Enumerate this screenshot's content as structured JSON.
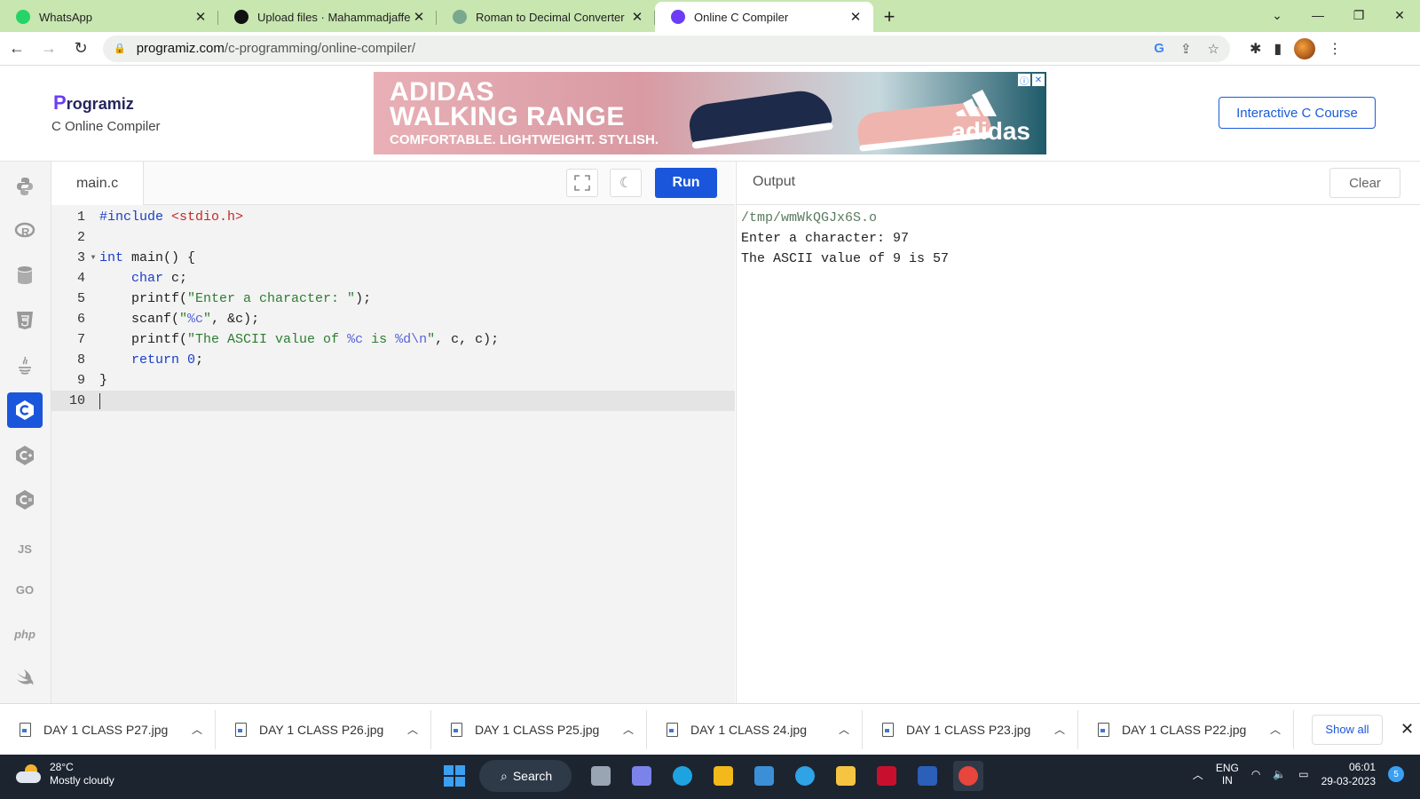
{
  "browser": {
    "tabs": [
      {
        "title": "WhatsApp",
        "favicon": "whatsapp-icon",
        "color": "#25d366",
        "active": false
      },
      {
        "title": "Upload files · Mahammadjaffer/C",
        "favicon": "github-icon",
        "color": "#111111",
        "active": false
      },
      {
        "title": "Roman to Decimal Converter",
        "favicon": "chatgpt-icon",
        "color": "#7aa88e",
        "active": false
      },
      {
        "title": "Online C Compiler",
        "favicon": "programiz-icon",
        "color": "#6c3df4",
        "active": true
      }
    ],
    "url_host": "programiz.com",
    "url_path": "/c-programming/online-compiler/"
  },
  "site": {
    "logo_text": "rogramiz",
    "logo_letter": "P",
    "subtitle": "C Online Compiler",
    "course_button": "Interactive C Course"
  },
  "ad": {
    "line1": "ADIDAS",
    "line2": "WALKING RANGE",
    "line3": "COMFORTABLE. LIGHTWEIGHT. STYLISH.",
    "brand": "adidas"
  },
  "sidebar": {
    "languages": [
      {
        "name": "python",
        "label": "",
        "active": false
      },
      {
        "name": "r",
        "label": "",
        "active": false
      },
      {
        "name": "sql",
        "label": "",
        "active": false
      },
      {
        "name": "html",
        "label": "",
        "active": false
      },
      {
        "name": "java",
        "label": "",
        "active": false
      },
      {
        "name": "c",
        "label": "",
        "active": true
      },
      {
        "name": "cpp",
        "label": "",
        "active": false
      },
      {
        "name": "csharp",
        "label": "",
        "active": false
      },
      {
        "name": "js",
        "label": "JS",
        "active": false
      },
      {
        "name": "go",
        "label": "GO",
        "active": false
      },
      {
        "name": "php",
        "label": "php",
        "active": false
      },
      {
        "name": "swift",
        "label": "",
        "active": false
      }
    ]
  },
  "editor": {
    "filename": "main.c",
    "run_label": "Run",
    "lines": [
      {
        "num": "1",
        "html": "<span class=\"kw\">#include</span> <span class=\"inc\">&lt;stdio.h&gt;</span>"
      },
      {
        "num": "2",
        "html": ""
      },
      {
        "num": "3",
        "html": "<span class=\"kw\">int</span> main() {",
        "fold": true
      },
      {
        "num": "4",
        "html": "    <span class=\"kw\">char</span> c;"
      },
      {
        "num": "5",
        "html": "    printf(<span class=\"str\">\"Enter a character: \"</span>);"
      },
      {
        "num": "6",
        "html": "    scanf(<span class=\"str\">\"</span><span class=\"fmt\">%c</span><span class=\"str\">\"</span>, &amp;c);"
      },
      {
        "num": "7",
        "html": "    printf(<span class=\"str\">\"The ASCII value of </span><span class=\"fmt\">%c</span><span class=\"str\"> is </span><span class=\"fmt\">%d\\n</span><span class=\"str\">\"</span>, c, c);"
      },
      {
        "num": "8",
        "html": "    <span class=\"kw\">return</span> <span class=\"num\">0</span>;"
      },
      {
        "num": "9",
        "html": "}"
      },
      {
        "num": "10",
        "html": "",
        "current": true
      }
    ]
  },
  "output": {
    "title": "Output",
    "clear_label": "Clear",
    "lines": [
      "/tmp/wmWkQGJx6S.o",
      "Enter a character: 97",
      "The ASCII value of 9 is 57"
    ]
  },
  "downloads": {
    "items": [
      "DAY 1 CLASS P27.jpg",
      "DAY 1 CLASS P26.jpg",
      "DAY 1 CLASS P25.jpg",
      "DAY 1 CLASS 24.jpg",
      "DAY 1 CLASS P23.jpg",
      "DAY 1 CLASS P22.jpg"
    ],
    "show_all": "Show all"
  },
  "taskbar": {
    "temperature": "28°C",
    "weather": "Mostly cloudy",
    "search_label": "Search",
    "apps": [
      {
        "name": "task-view-icon",
        "color": "#9aa5b4"
      },
      {
        "name": "teams-chat-icon",
        "color": "#7b83eb"
      },
      {
        "name": "edge-icon",
        "color": "#1fa3e0"
      },
      {
        "name": "store-icon",
        "color": "#f3b81a"
      },
      {
        "name": "mylic-icon",
        "color": "#3b8fd6"
      },
      {
        "name": "help-icon",
        "color": "#2ea3e6"
      },
      {
        "name": "file-explorer-icon",
        "color": "#f5c542"
      },
      {
        "name": "mcafee-icon",
        "color": "#c8102e"
      },
      {
        "name": "word-icon",
        "color": "#2b5fb8"
      },
      {
        "name": "chrome-icon",
        "color": "#e8453c"
      }
    ],
    "lang_top": "ENG",
    "lang_bottom": "IN",
    "time": "06:01",
    "date": "29-03-2023",
    "notifications": "5"
  }
}
